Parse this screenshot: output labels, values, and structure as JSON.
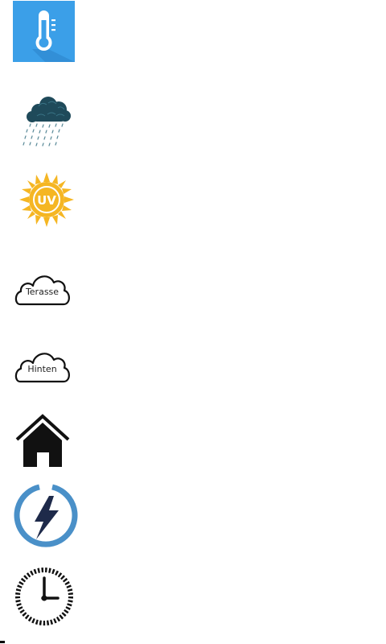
{
  "icons": [
    {
      "name": "thermometer-icon",
      "color": "#3b9fe8"
    },
    {
      "name": "rain-cloud-icon",
      "color": "#1f4a5a"
    },
    {
      "name": "uv-sun-icon",
      "color": "#f5b623",
      "label": "UV"
    },
    {
      "name": "cloud-terasse-icon",
      "label": "Terasse"
    },
    {
      "name": "cloud-hinten-icon",
      "label": "Hinten"
    },
    {
      "name": "home-icon",
      "color": "#111111"
    },
    {
      "name": "power-icon",
      "color": "#4a90c8",
      "bolt_color": "#1e2a4a"
    },
    {
      "name": "clock-icon",
      "color": "#111111"
    }
  ]
}
